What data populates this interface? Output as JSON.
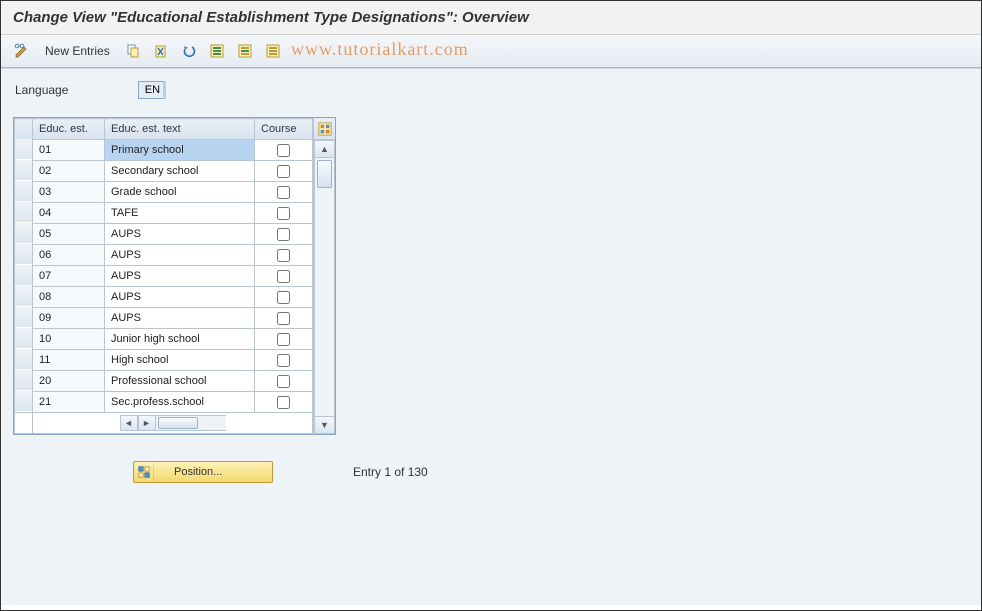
{
  "header": {
    "title": "Change View \"Educational Establishment Type Designations\": Overview"
  },
  "toolbar": {
    "new_entries_label": "New Entries"
  },
  "watermark": "www.tutorialkart.com",
  "language": {
    "label": "Language",
    "value": "EN"
  },
  "grid": {
    "columns": {
      "educ_est": "Educ. est.",
      "educ_est_text": "Educ. est. text",
      "course": "Course"
    },
    "rows": [
      {
        "code": "01",
        "text": "Primary school",
        "course": false,
        "selected": true
      },
      {
        "code": "02",
        "text": "Secondary school",
        "course": false
      },
      {
        "code": "03",
        "text": "Grade school",
        "course": false
      },
      {
        "code": "04",
        "text": "TAFE",
        "course": false
      },
      {
        "code": "05",
        "text": "AUPS",
        "course": false
      },
      {
        "code": "06",
        "text": "AUPS",
        "course": false
      },
      {
        "code": "07",
        "text": "AUPS",
        "course": false
      },
      {
        "code": "08",
        "text": "AUPS",
        "course": false
      },
      {
        "code": "09",
        "text": "AUPS",
        "course": false
      },
      {
        "code": "10",
        "text": "Junior high school",
        "course": false
      },
      {
        "code": "11",
        "text": "High school",
        "course": false
      },
      {
        "code": "20",
        "text": "Professional school",
        "course": false
      },
      {
        "code": "21",
        "text": "Sec.profess.school",
        "course": false
      }
    ]
  },
  "footer": {
    "position_label": "Position...",
    "entry_text": "Entry 1 of 130"
  }
}
